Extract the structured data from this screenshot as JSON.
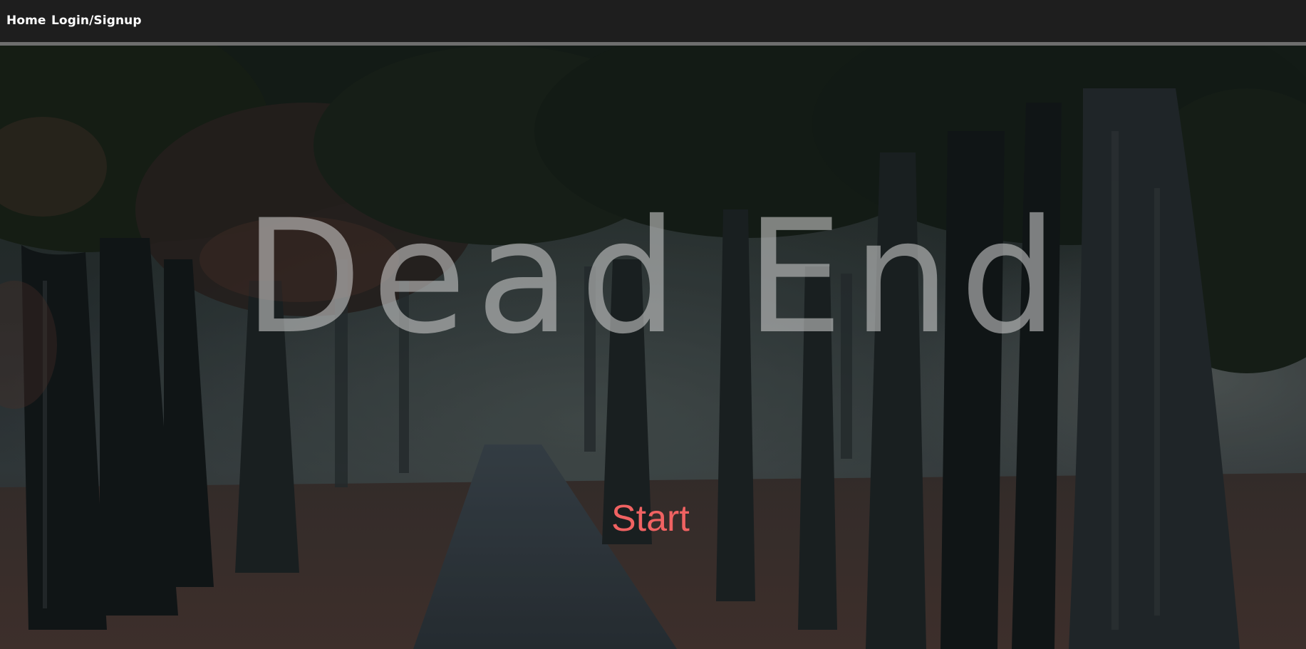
{
  "nav": {
    "home_label": "Home",
    "login_label": "Login/Signup"
  },
  "hero": {
    "title": "Dead End",
    "start_label": "Start",
    "background_image": "misty-forest-road-icon"
  },
  "colors": {
    "navbar_bg": "#1e1e1e",
    "navbar_border": "#6e6e6e",
    "title_color": "#cdcdcd",
    "start_color": "#f06262"
  }
}
